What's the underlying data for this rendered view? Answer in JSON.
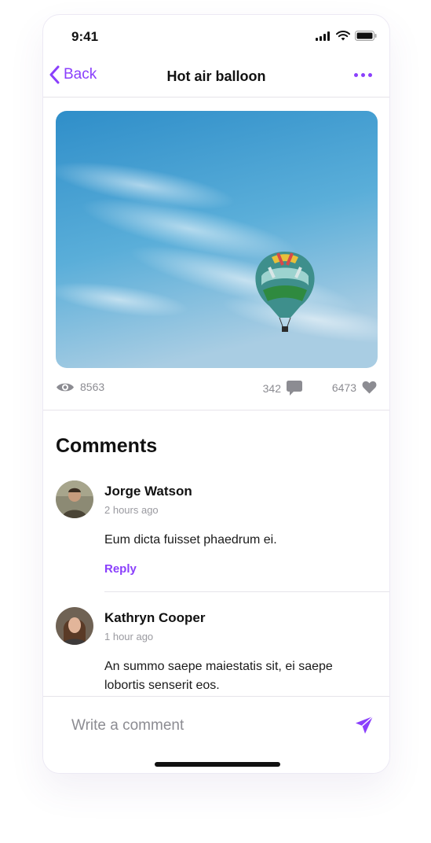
{
  "status_bar": {
    "time": "9:41"
  },
  "nav": {
    "back_label": "Back",
    "title": "Hot air balloon"
  },
  "post": {
    "views": "8563",
    "comments_count": "342",
    "likes": "6473"
  },
  "comments_section": {
    "heading": "Comments",
    "items": [
      {
        "name": "Jorge Watson",
        "time": "2 hours ago",
        "text": "Eum dicta fuisset phaedrum ei.",
        "reply_label": "Reply"
      },
      {
        "name": "Kathryn Cooper",
        "time": "1 hour ago",
        "text": "An summo saepe maiestatis sit, ei saepe lobortis senserit eos."
      }
    ]
  },
  "composer": {
    "placeholder": "Write a comment"
  },
  "colors": {
    "accent": "#8a3ffc",
    "muted": "#8c8c92",
    "sky": "#4aa3d6"
  },
  "icons": [
    "signal-icon",
    "wifi-icon",
    "battery-icon",
    "chevron-left-icon",
    "more-icon",
    "eye-icon",
    "comment-icon",
    "heart-icon",
    "send-icon"
  ]
}
